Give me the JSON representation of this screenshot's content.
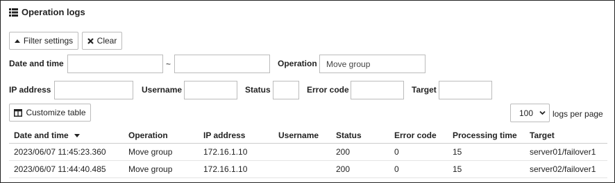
{
  "page": {
    "title": "Operation logs",
    "title_icon": "list-icon"
  },
  "toolbar": {
    "filter_label": "Filter settings",
    "clear_label": "Clear"
  },
  "filters": {
    "date_label": "Date and time",
    "date_from": "",
    "date_sep": "~",
    "date_to": "",
    "operation_label": "Operation",
    "operation_value": "Move group",
    "ip_label": "IP address",
    "ip_value": "",
    "username_label": "Username",
    "username_value": "",
    "status_label": "Status",
    "status_value": "",
    "error_label": "Error code",
    "error_value": "",
    "target_label": "Target",
    "target_value": ""
  },
  "table_controls": {
    "customize_label": "Customize table",
    "per_page_value": "100",
    "per_page_options": [
      "100"
    ],
    "per_page_suffix": "logs per page"
  },
  "table": {
    "columns": [
      "Date and time",
      "Operation",
      "IP address",
      "Username",
      "Status",
      "Error code",
      "Processing time",
      "Target"
    ],
    "sorted_column": "Date and time",
    "sort_direction": "descending",
    "rows": [
      [
        "2023/06/07 11:45:23.360",
        "Move group",
        "172.16.1.10",
        "",
        "200",
        "0",
        "15",
        "server01/failover1"
      ],
      [
        "2023/06/07 11:44:40.485",
        "Move group",
        "172.16.1.10",
        "",
        "200",
        "0",
        "15",
        "server02/failover1"
      ]
    ]
  }
}
